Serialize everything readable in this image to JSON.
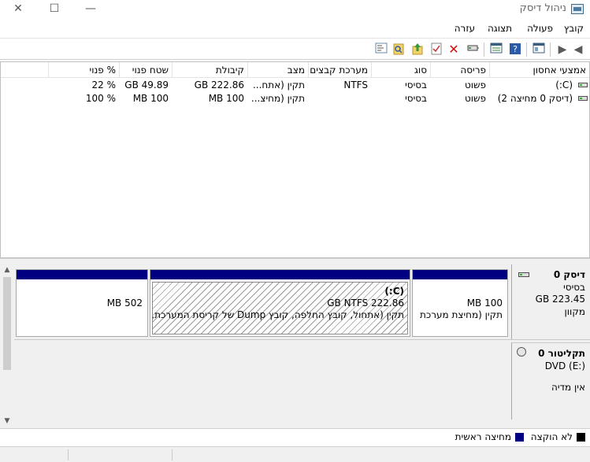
{
  "window": {
    "title": "ניהול דיסק",
    "minimize_glyph": "—",
    "maximize_glyph": "☐",
    "close_glyph": "✕"
  },
  "menu": {
    "file": "קובץ",
    "action": "פעולה",
    "view": "תצוגה",
    "help": "עזרה"
  },
  "toolbar": {
    "icons": [
      "back-icon",
      "forward-icon",
      "show-hide-console-tree-icon",
      "help-icon",
      "properties-icon",
      "connect-disk-icon",
      "delete-icon",
      "check-icon",
      "up-folder-icon",
      "search-icon",
      "properties-view-icon"
    ]
  },
  "list": {
    "columns": {
      "volume": "אמצעי אחסון",
      "layout": "פריסה",
      "type": "סוג",
      "filesystem": "מערכת קבצים",
      "status": "מצב",
      "capacity": "קיבולת",
      "free": "שטח פנוי",
      "pct_free": "% פנוי"
    },
    "rows": [
      {
        "volume": "(C:)",
        "layout": "פשוט",
        "type": "בסיסי",
        "filesystem": "NTFS",
        "status": "תקין (אתח...",
        "capacity": "GB 222.86",
        "free": "GB 49.89",
        "pct_free": "% 22"
      },
      {
        "volume": "(דיסק 0 מחיצה 2)",
        "layout": "פשוט",
        "type": "בסיסי",
        "filesystem": "",
        "status": "תקין (מחיצ...",
        "capacity": "MB 100",
        "free": "MB 100",
        "pct_free": "% 100"
      }
    ]
  },
  "disks": [
    {
      "name": "דיסק 0",
      "type": "בסיסי",
      "size": "GB 223.45",
      "state": "מקוון",
      "partitions": [
        {
          "line1": "MB 100",
          "line2": "תקין (מחיצת מערכת"
        },
        {
          "title": "(C:)",
          "line1": "GB NTFS 222.86",
          "line2": "תקין (אתחול, קובץ החלפה, קובץ Dump של קריסת המערכת, מ"
        },
        {
          "line1": "MB 502",
          "line2": ""
        }
      ]
    },
    {
      "name": "תקליטור 0",
      "type": "DVD (E:)",
      "state": "אין מדיה"
    }
  ],
  "legend": {
    "unallocated": "לא הוקצה",
    "primary": "מחיצה ראשית",
    "colors": {
      "unallocated": "#000000",
      "primary": "#000080"
    }
  },
  "colors": {
    "partition_header": "#000080",
    "panel_bg": "#f0f0f0"
  }
}
